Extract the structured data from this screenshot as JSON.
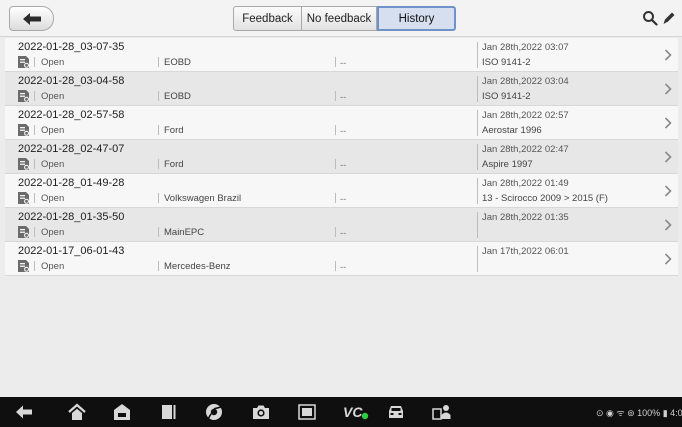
{
  "header": {
    "tabs": [
      {
        "label": "Feedback",
        "active": false
      },
      {
        "label": "No feedback",
        "active": false
      },
      {
        "label": "History",
        "active": true
      }
    ]
  },
  "rows": [
    {
      "title": "2022-01-28_03-07-35",
      "status": "Open",
      "make": "EOBD",
      "dash": "--",
      "date": "Jan 28th,2022 03:07",
      "desc": "ISO 9141-2"
    },
    {
      "title": "2022-01-28_03-04-58",
      "status": "Open",
      "make": "EOBD",
      "dash": "--",
      "date": "Jan 28th,2022 03:04",
      "desc": "ISO 9141-2"
    },
    {
      "title": "2022-01-28_02-57-58",
      "status": "Open",
      "make": "Ford",
      "dash": "--",
      "date": "Jan 28th,2022 02:57",
      "desc": "Aerostar 1996"
    },
    {
      "title": "2022-01-28_02-47-07",
      "status": "Open",
      "make": "Ford",
      "dash": "--",
      "date": "Jan 28th,2022 02:47",
      "desc": "Aspire 1997"
    },
    {
      "title": "2022-01-28_01-49-28",
      "status": "Open",
      "make": "Volkswagen Brazil",
      "dash": "--",
      "date": "Jan 28th,2022 01:49",
      "desc": "13 - Scirocco 2009 > 2015 (F)"
    },
    {
      "title": "2022-01-28_01-35-50",
      "status": "Open",
      "make": "MainEPC",
      "dash": "--",
      "date": "Jan 28th,2022 01:35",
      "desc": ""
    },
    {
      "title": "2022-01-17_06-01-43",
      "status": "Open",
      "make": "Mercedes-Benz",
      "dash": "--",
      "date": "Jan 17th,2022 06:01",
      "desc": ""
    }
  ],
  "navbar": {
    "vci_label": "VC",
    "status_text": "100%",
    "clock": "4:00"
  },
  "colors": {
    "active_tab_border": "#6f93c8",
    "active_tab_fill": "#d6dff0",
    "vci_dot": "#2ecc40"
  }
}
